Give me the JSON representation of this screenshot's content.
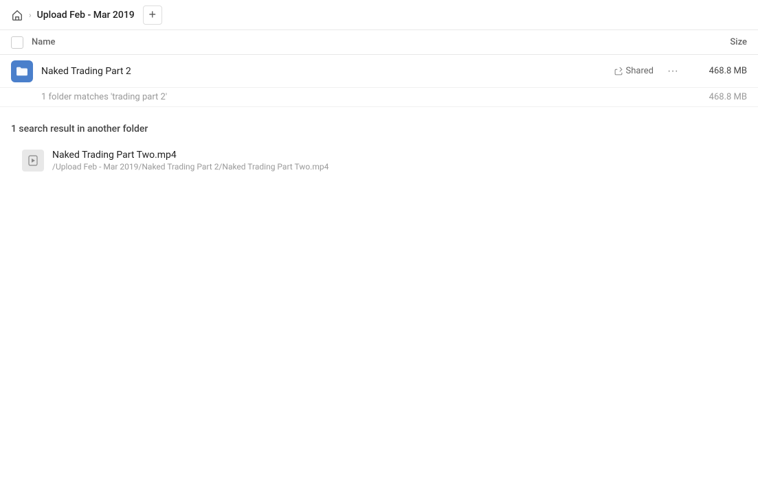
{
  "header": {
    "home_icon": "🏠",
    "chevron": "›",
    "breadcrumb": "Upload Feb - Mar 2019",
    "add_button_label": "+"
  },
  "columns": {
    "name_label": "Name",
    "size_label": "Size"
  },
  "folder": {
    "name": "Naked Trading Part 2",
    "shared_label": "Shared",
    "size": "468.8 MB",
    "more_label": "···"
  },
  "matches": {
    "text": "1 folder matches 'trading part 2'",
    "size": "468.8 MB"
  },
  "search_result": {
    "heading": "1 search result in another folder",
    "file_name": "Naked Trading Part Two.mp4",
    "file_path": "/Upload Feb - Mar 2019/Naked Trading Part 2/Naked Trading Part Two.mp4"
  }
}
